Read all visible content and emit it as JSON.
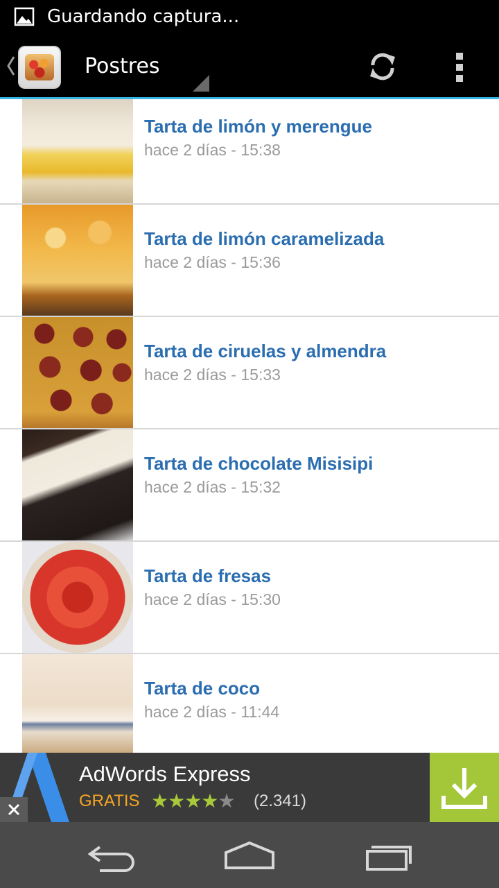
{
  "status_bar": {
    "notification_icon": "image-icon",
    "text": "Guardando captura..."
  },
  "action_bar": {
    "title": "Postres",
    "up_icon": "chevron-left-icon",
    "app_icon": "cake-icon",
    "refresh_icon": "refresh-icon",
    "overflow_icon": "more-vert-icon",
    "accent_color": "#33b5e5"
  },
  "recipes": [
    {
      "title": "Tarta de limón y merengue",
      "date": "hace 2 días - 15:38",
      "thumb": "lemon-meringue"
    },
    {
      "title": "Tarta de limón caramelizada",
      "date": "hace 2 días - 15:36",
      "thumb": "lemon-caramel"
    },
    {
      "title": "Tarta de ciruelas y almendra",
      "date": "hace 2 días - 15:33",
      "thumb": "plum-almond"
    },
    {
      "title": "Tarta de chocolate Misisipi",
      "date": "hace 2 días - 15:32",
      "thumb": "mississippi"
    },
    {
      "title": "Tarta de fresas",
      "date": "hace 2 días - 15:30",
      "thumb": "strawberry"
    },
    {
      "title": "Tarta de coco",
      "date": "hace 2 días - 11:44",
      "thumb": "coconut"
    }
  ],
  "ad": {
    "title": "AdWords Express",
    "price": "GRATIS",
    "rating": 4,
    "rating_max": 5,
    "reviews": "(2.341)",
    "close_icon": "close-icon",
    "install_icon": "download-icon",
    "install_color": "#a4c639"
  },
  "nav_bar": {
    "back_icon": "back-icon",
    "home_icon": "home-icon",
    "recents_icon": "recents-icon"
  }
}
